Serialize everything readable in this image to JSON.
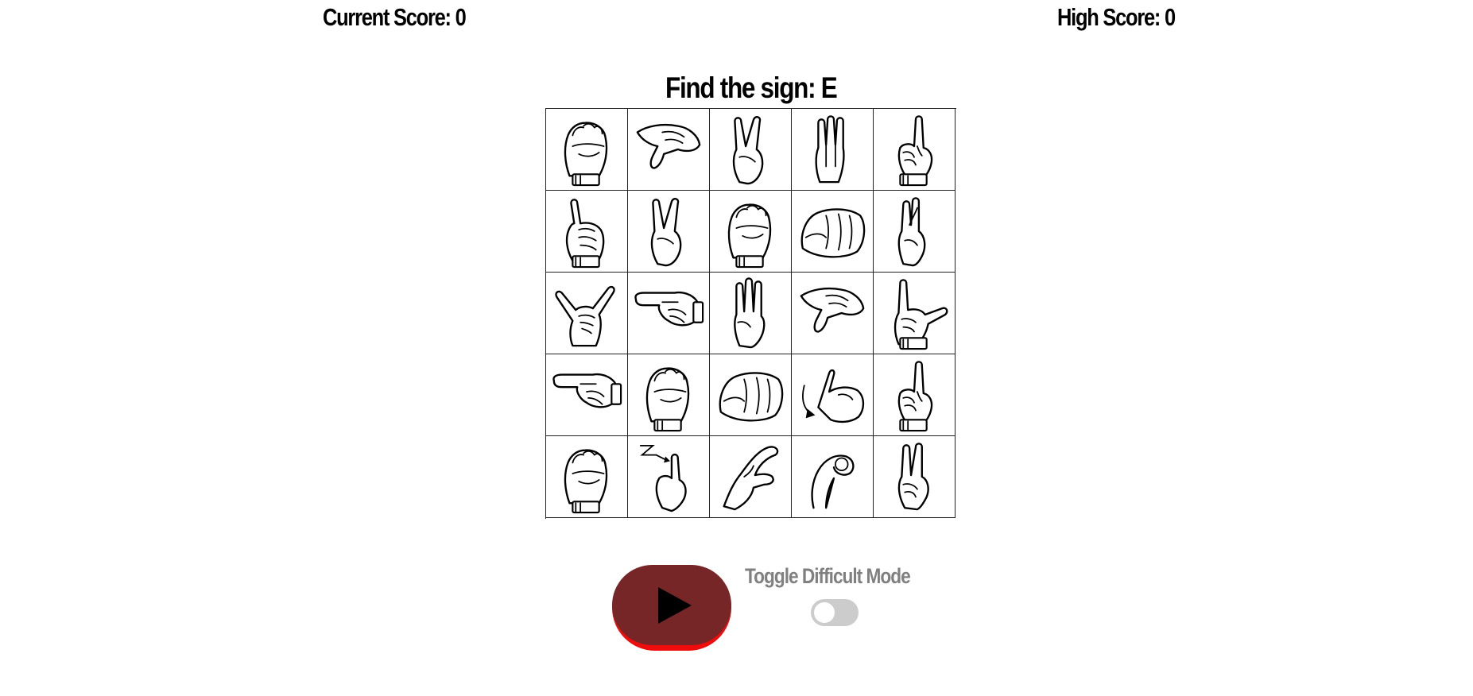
{
  "header": {
    "current_score": "Current Score: 0",
    "high_score": "High Score: 0"
  },
  "prompt": {
    "text": "Find the sign: E"
  },
  "grid": {
    "rows": 5,
    "columns": 5,
    "cells": [
      {
        "icon": "asl-fist-thumb-over-icon"
      },
      {
        "icon": "asl-two-fingers-down-icon"
      },
      {
        "icon": "asl-v-sign-icon"
      },
      {
        "icon": "asl-flat-fingers-up-icon"
      },
      {
        "icon": "asl-index-up-icon"
      },
      {
        "icon": "asl-pinky-up-icon"
      },
      {
        "icon": "asl-v-fingers-icon"
      },
      {
        "icon": "asl-fist-thumb-tucked-icon"
      },
      {
        "icon": "asl-fist-side-icon"
      },
      {
        "icon": "asl-crossed-fingers-up-icon"
      },
      {
        "icon": "asl-thumb-pinky-out-icon"
      },
      {
        "icon": "asl-index-point-side-icon"
      },
      {
        "icon": "asl-three-fingers-up-icon"
      },
      {
        "icon": "asl-index-point-down-icon"
      },
      {
        "icon": "asl-l-sign-icon"
      },
      {
        "icon": "asl-two-fingers-side-icon"
      },
      {
        "icon": "asl-curled-fingers-icon"
      },
      {
        "icon": "asl-fist-front-icon"
      },
      {
        "icon": "asl-pinky-j-arrow-icon"
      },
      {
        "icon": "asl-index-hook-up-icon"
      },
      {
        "icon": "asl-fist-thumb-front-icon"
      },
      {
        "icon": "asl-index-z-arrow-icon"
      },
      {
        "icon": "asl-c-shape-icon"
      },
      {
        "icon": "asl-o-shape-icon"
      },
      {
        "icon": "asl-crossed-fingers-icon"
      }
    ]
  },
  "controls": {
    "play_button": {
      "icon": "play-icon",
      "fill": "#762626",
      "rim": "#ee0c0c"
    },
    "toggle_label": "Toggle Difficult Mode",
    "toggle_state": "off"
  }
}
